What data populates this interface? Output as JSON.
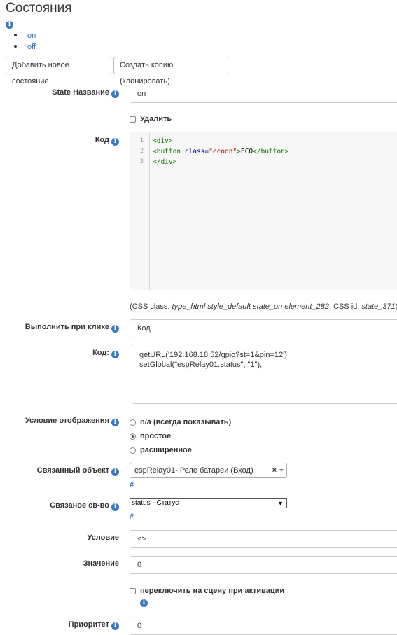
{
  "page": {
    "title": "Состояния"
  },
  "states": [
    {
      "label": "on"
    },
    {
      "label": "off"
    }
  ],
  "buttons": {
    "add_state": "Добавить новое состояние",
    "clone": "Создать копию (клонировать)"
  },
  "form": {
    "state_name": {
      "label": "State Название",
      "value": "on"
    },
    "delete": {
      "label": "Удалить",
      "checked": false
    },
    "code": {
      "label": "Код",
      "line_numbers": [
        "1",
        "2",
        "3"
      ],
      "line1": "<div>",
      "line2_tag_open": "<button ",
      "line2_attr": "class=",
      "line2_str": "\"ecoon\"",
      "line2_gt": ">",
      "line2_text": "ECO",
      "line2_tag_close": "</button>",
      "line3": "</div>"
    },
    "css_info": {
      "prefix": "(CSS class: ",
      "classes": "type_html style_default state_on element_282",
      "middle": ", CSS id: ",
      "id": "state_371",
      "suffix": ")"
    },
    "on_click": {
      "label": "Выполнить при клике",
      "value": "Код"
    },
    "script": {
      "label": "Код:",
      "line1": "getURL('192.168.18.52/gpio?st=1&pin=12');",
      "line2": "setGlobal(\"espRelay01.status\", \"1\");"
    },
    "display_condition": {
      "label": "Условие отображения",
      "options": [
        {
          "label": "n/a (всегда показывать)",
          "selected": false
        },
        {
          "label": "простое",
          "selected": true
        },
        {
          "label": "расширенное",
          "selected": false
        }
      ]
    },
    "linked_object": {
      "label": "Связанный объект",
      "value": "espRelay01- Реле батареи (Вход)",
      "clear": "×",
      "link": "#"
    },
    "linked_property": {
      "label": "Связаное св-во",
      "value": "status - Статус",
      "arrow": "▼",
      "link": "#"
    },
    "condition": {
      "label": "Условие",
      "value": "<>"
    },
    "value": {
      "label": "Значение",
      "value": "0"
    },
    "switch_scene": {
      "label": "переключить на сцену при активации",
      "checked": false
    },
    "priority": {
      "label": "Приоритет",
      "value": "0"
    }
  },
  "colors": {
    "accent": "#2a6fb8",
    "info_icon": "#3a78c3"
  }
}
